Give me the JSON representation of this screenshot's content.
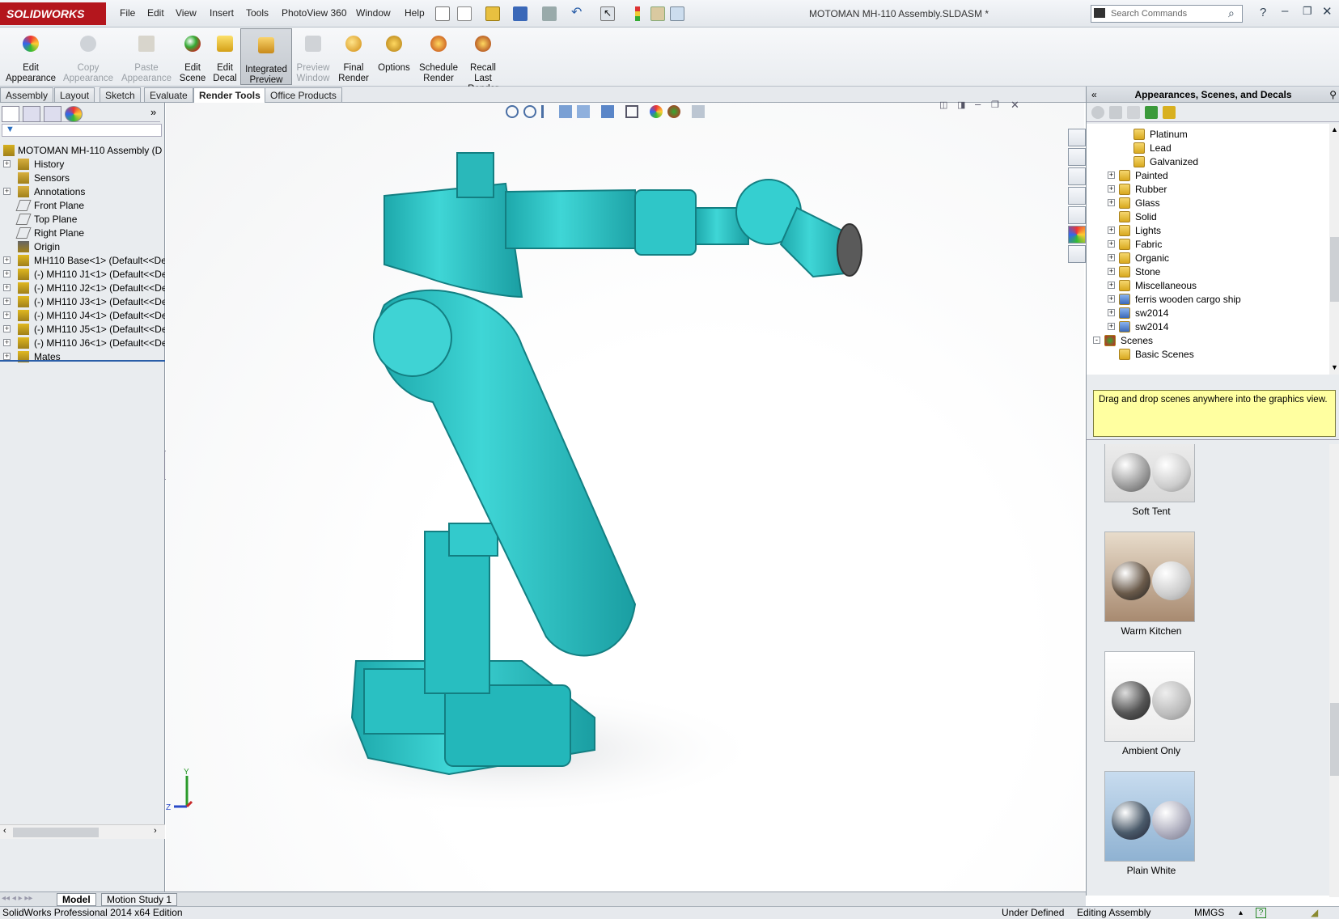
{
  "app": {
    "brand": "SOLIDWORKS",
    "document_title": "MOTOMAN MH-110 Assembly.SLDASM *"
  },
  "menu": [
    "File",
    "Edit",
    "View",
    "Insert",
    "Tools",
    "PhotoView 360",
    "Window",
    "Help"
  ],
  "search": {
    "placeholder": "Search Commands"
  },
  "ribbon": [
    {
      "label1": "Edit",
      "label2": "Appearance",
      "label3": "",
      "enabled": true
    },
    {
      "label1": "Copy",
      "label2": "Appearance",
      "label3": "",
      "enabled": false
    },
    {
      "label1": "Paste",
      "label2": "Appearance",
      "label3": "",
      "enabled": false
    },
    {
      "label1": "Edit",
      "label2": "Scene",
      "label3": "",
      "enabled": true
    },
    {
      "label1": "Edit",
      "label2": "Decal",
      "label3": "",
      "enabled": true
    },
    {
      "label1": "Integrated",
      "label2": "Preview",
      "label3": "",
      "enabled": true
    },
    {
      "label1": "Preview",
      "label2": "Window",
      "label3": "",
      "enabled": false
    },
    {
      "label1": "Final",
      "label2": "Render",
      "label3": "",
      "enabled": true
    },
    {
      "label1": "Options",
      "label2": "",
      "label3": "",
      "enabled": true
    },
    {
      "label1": "Schedule",
      "label2": "Render",
      "label3": "",
      "enabled": true
    },
    {
      "label1": "Recall",
      "label2": "Last",
      "label3": "Render",
      "enabled": true
    }
  ],
  "command_tabs": [
    "Assembly",
    "Layout",
    "Sketch",
    "Evaluate",
    "Render Tools",
    "Office Products"
  ],
  "selected_tab": "Render Tools",
  "feature_tree": [
    {
      "label": "MOTOMAN MH-110 Assembly  (D",
      "expand": ""
    },
    {
      "label": "History",
      "expand": "+"
    },
    {
      "label": "Sensors",
      "expand": ""
    },
    {
      "label": "Annotations",
      "expand": "+"
    },
    {
      "label": "Front Plane",
      "expand": ""
    },
    {
      "label": "Top Plane",
      "expand": ""
    },
    {
      "label": "Right Plane",
      "expand": ""
    },
    {
      "label": "Origin",
      "expand": ""
    },
    {
      "label": "MH110 Base<1> (Default<<De",
      "expand": "+"
    },
    {
      "label": "(-) MH110 J1<1> (Default<<De",
      "expand": "+"
    },
    {
      "label": "(-) MH110 J2<1> (Default<<De",
      "expand": "+"
    },
    {
      "label": "(-) MH110 J3<1> (Default<<De",
      "expand": "+"
    },
    {
      "label": "(-) MH110 J4<1> (Default<<De",
      "expand": "+"
    },
    {
      "label": "(-) MH110 J5<1> (Default<<De",
      "expand": "+"
    },
    {
      "label": "(-) MH110 J6<1> (Default<<De",
      "expand": "+"
    },
    {
      "label": "Mates",
      "expand": "+"
    }
  ],
  "right_panel": {
    "title": "Appearances, Scenes, and Decals",
    "tree": [
      {
        "label": "Platinum",
        "indent": 2,
        "expand": ""
      },
      {
        "label": "Lead",
        "indent": 2,
        "expand": ""
      },
      {
        "label": "Galvanized",
        "indent": 2,
        "expand": ""
      },
      {
        "label": "Painted",
        "indent": 1,
        "expand": "+"
      },
      {
        "label": "Rubber",
        "indent": 1,
        "expand": "+"
      },
      {
        "label": "Glass",
        "indent": 1,
        "expand": "+"
      },
      {
        "label": "Solid",
        "indent": 1,
        "expand": ""
      },
      {
        "label": "Lights",
        "indent": 1,
        "expand": "+"
      },
      {
        "label": "Fabric",
        "indent": 1,
        "expand": "+"
      },
      {
        "label": "Organic",
        "indent": 1,
        "expand": "+"
      },
      {
        "label": "Stone",
        "indent": 1,
        "expand": "+"
      },
      {
        "label": "Miscellaneous",
        "indent": 1,
        "expand": "+"
      },
      {
        "label": "ferris wooden cargo ship",
        "indent": 1,
        "expand": "+"
      },
      {
        "label": "sw2014",
        "indent": 1,
        "expand": "+"
      },
      {
        "label": "sw2014",
        "indent": 1,
        "expand": "+"
      },
      {
        "label": "Scenes",
        "indent": 0,
        "expand": "-"
      },
      {
        "label": "Basic Scenes",
        "indent": 1,
        "expand": ""
      }
    ],
    "tip": "Drag and drop scenes anywhere into the graphics view.",
    "scenes": [
      "Soft Tent",
      "Warm Kitchen",
      "Ambient Only",
      "Plain White"
    ]
  },
  "bottom_tabs": [
    "Model",
    "Motion Study 1"
  ],
  "status": {
    "edition": "SolidWorks Professional 2014 x64 Edition",
    "state": "Under Defined",
    "mode": "Editing Assembly",
    "units": "MMGS"
  },
  "triad": {
    "y": "Y",
    "z": "Z"
  },
  "colors": {
    "robot": "#2bc2c4",
    "brand": "#b4161d",
    "tip": "#ffffa0"
  }
}
